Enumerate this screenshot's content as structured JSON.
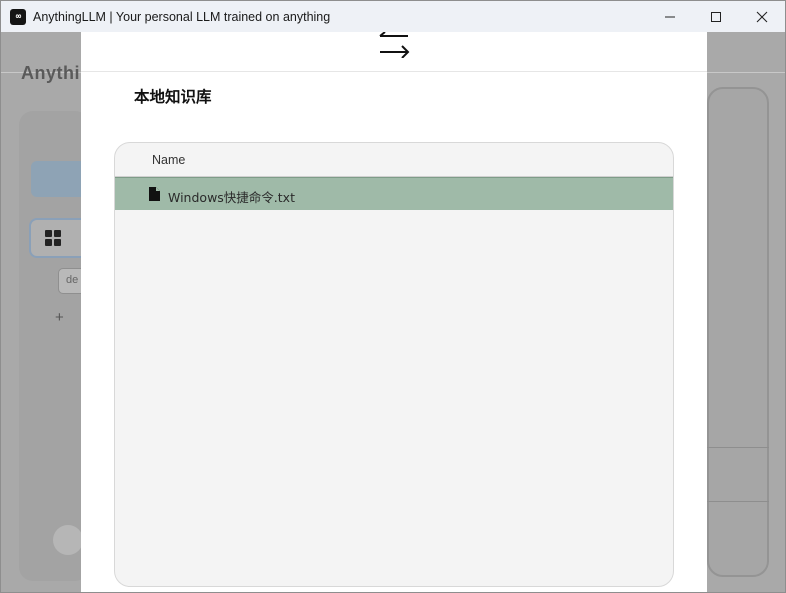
{
  "window": {
    "title": "AnythingLLM | Your personal LLM trained on anything",
    "logo_text": "∞"
  },
  "background": {
    "brand": "AnythingLLM",
    "thread_label": "de"
  },
  "modal": {
    "title": "本地知识库",
    "table": {
      "columns": [
        "Name"
      ],
      "rows": [
        {
          "name": "Windows快捷命令.txt",
          "icon": "file-icon",
          "selected": true
        }
      ]
    }
  },
  "colors": {
    "selected_row": "#9fbaa8",
    "panel_bg": "#f4f4f4",
    "overlay": "#a9a9a9"
  }
}
